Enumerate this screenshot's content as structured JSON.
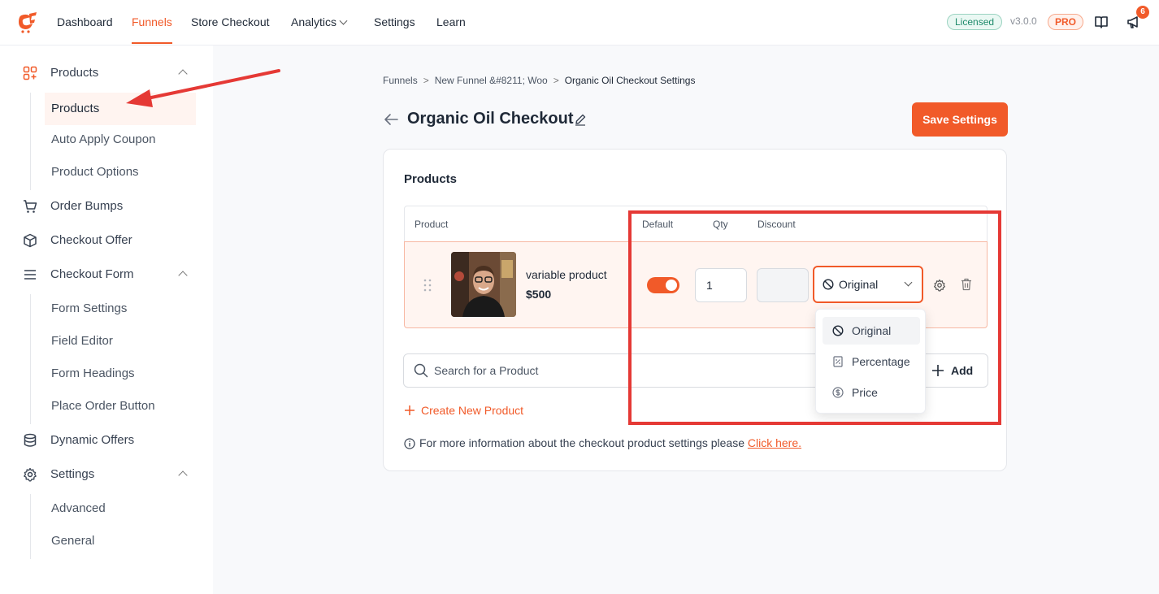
{
  "topnav": {
    "items": [
      {
        "label": "Dashboard"
      },
      {
        "label": "Funnels"
      },
      {
        "label": "Store Checkout"
      },
      {
        "label": "Analytics"
      },
      {
        "label": "Settings"
      },
      {
        "label": "Learn"
      }
    ],
    "licensed": "Licensed",
    "version": "v3.0.0",
    "pro": "PRO",
    "notifications": "6"
  },
  "sidebar": {
    "groups": [
      {
        "label": "Products",
        "icon": "grid-plus-icon",
        "subitems": [
          "Products",
          "Auto Apply Coupon",
          "Product Options"
        ]
      },
      {
        "label": "Order Bumps",
        "icon": "cart-icon"
      },
      {
        "label": "Checkout Offer",
        "icon": "box-icon"
      },
      {
        "label": "Checkout Form",
        "icon": "menu-icon",
        "subitems": [
          "Form Settings",
          "Field Editor",
          "Form Headings",
          "Place Order Button"
        ]
      },
      {
        "label": "Dynamic Offers",
        "icon": "database-icon"
      },
      {
        "label": "Settings",
        "icon": "gear-icon",
        "subitems": [
          "Advanced",
          "General"
        ]
      }
    ]
  },
  "breadcrumb": [
    "Funnels",
    "New Funnel &#8211; Woo",
    "Organic Oil Checkout Settings"
  ],
  "page": {
    "title": "Organic Oil Checkout",
    "save_label": "Save Settings"
  },
  "products_card": {
    "title": "Products",
    "columns": [
      "Product",
      "Default",
      "Qty",
      "Discount"
    ],
    "row": {
      "name": "variable product",
      "price": "$500",
      "default_enabled": true,
      "qty": "1",
      "discount_value": "",
      "discount_type": "Original"
    },
    "discount_options": [
      "Original",
      "Percentage",
      "Price"
    ],
    "search_placeholder": "Search for a Product",
    "add_label": "Add",
    "create_label": "Create New Product",
    "info_text": "For more information about the checkout product settings please",
    "info_link": "Click here."
  },
  "colors": {
    "accent": "#f15a29",
    "annotation": "#e53935"
  }
}
